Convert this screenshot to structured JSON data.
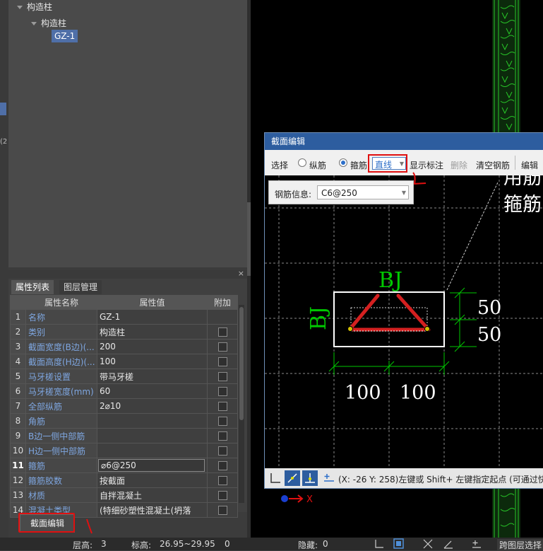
{
  "tree": {
    "root_label": "构造柱",
    "child_label": "构造柱",
    "leaf_label": "GZ-1"
  },
  "left_mark": "(2",
  "properties": {
    "tabs": [
      "属性列表",
      "图层管理"
    ],
    "close_glyph": "×",
    "headers": {
      "name": "属性名称",
      "value": "属性值",
      "add": "附加"
    },
    "rows": [
      {
        "no": "1",
        "name": "名称",
        "value": "GZ-1",
        "checkbox": false
      },
      {
        "no": "2",
        "name": "类别",
        "value": "构造柱",
        "checkbox": true
      },
      {
        "no": "3",
        "name": "截面宽度(B边)(...",
        "value": "200",
        "checkbox": true
      },
      {
        "no": "4",
        "name": "截面高度(H边)(...",
        "value": "100",
        "checkbox": true
      },
      {
        "no": "5",
        "name": "马牙槎设置",
        "value": "带马牙槎",
        "checkbox": true
      },
      {
        "no": "6",
        "name": "马牙槎宽度(mm)",
        "value": "60",
        "checkbox": true
      },
      {
        "no": "7",
        "name": "全部纵筋",
        "value": "2⌀10",
        "checkbox": true
      },
      {
        "no": "8",
        "name": "角筋",
        "value": "",
        "checkbox": true
      },
      {
        "no": "9",
        "name": "B边一侧中部筋",
        "value": "",
        "checkbox": true
      },
      {
        "no": "10",
        "name": "H边一侧中部筋",
        "value": "",
        "checkbox": true
      },
      {
        "no": "11",
        "name": "箍筋",
        "value": "⌀6@250",
        "checkbox": true
      },
      {
        "no": "12",
        "name": "箍筋胶数",
        "value": "按截面",
        "checkbox": true
      },
      {
        "no": "13",
        "name": "材质",
        "value": "自拌混凝土",
        "checkbox": true
      },
      {
        "no": "14",
        "name": "混凝土类型",
        "value": "(特细砂塑性混凝土(坍落",
        "checkbox": true
      }
    ]
  },
  "section_edit_button": "截面编辑",
  "annotation_mark": "1",
  "dialog": {
    "title": "截面编辑",
    "toolbar": {
      "select": "选择",
      "longitudinal": "纵筋",
      "stirrup": "箍筋",
      "line_type": "直线",
      "show_annotation": "显示标注",
      "delete": "删除",
      "clear_rebar": "清空钢筋",
      "edit_more": "编辑"
    },
    "rebar_info": {
      "label": "钢筋信息:",
      "value": "C6@250"
    },
    "canvas_text": {
      "top_label": "BJ",
      "side_label": "BJ",
      "dim_50_a": "50",
      "dim_50_b": "50",
      "dim_100_a": "100",
      "dim_100_b": "100",
      "hint_line1": "用筋",
      "hint_line2": "箍筋"
    },
    "coords": "(X: -26 Y: 258)左键或 Shift+ 左键指定起点 (可通过快"
  },
  "axis_label": "X",
  "status": {
    "floor_label": "层高:",
    "floor_value": "3",
    "elev_label": "标高:",
    "elev_value": "26.95~29.95",
    "count": "0",
    "hidden_label": "隐藏:",
    "hidden_value": "0",
    "cross_layer": "跨图层选择"
  },
  "colors": {
    "accent_blue": "#2d5d9f",
    "annotation_red": "#e01010",
    "cad_green": "#00c800",
    "rebar_red": "#d42020"
  }
}
